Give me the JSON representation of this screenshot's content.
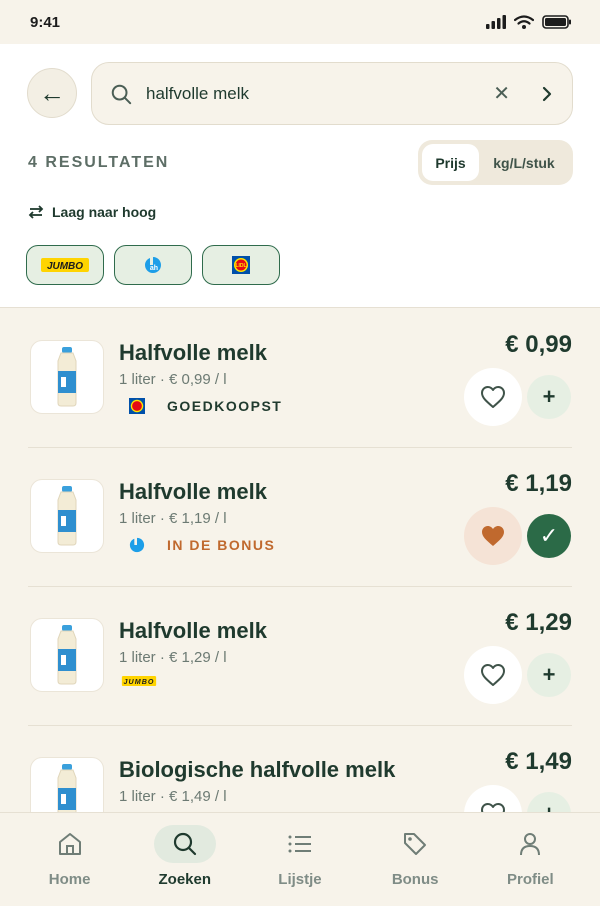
{
  "status": {
    "time": "9:41"
  },
  "search": {
    "query": "halfvolle melk"
  },
  "results": {
    "count_label": "4 RESULTATEN"
  },
  "toggle": {
    "options": [
      "Prijs",
      "kg/L/stuk"
    ],
    "active": "Prijs"
  },
  "sort": {
    "label": "Laag naar hoog"
  },
  "store_filters": [
    {
      "name": "JUMBO",
      "logo": "jumbo-logo"
    },
    {
      "name": "AH",
      "logo": "ah-logo"
    },
    {
      "name": "LIDL",
      "logo": "lidl-logo"
    }
  ],
  "products": [
    {
      "name": "Halfvolle melk",
      "meta": "1 liter · € 0,99 / l",
      "price": "€ 0,99",
      "store": "lidl-logo",
      "tag": "GOEDKOOPST",
      "tag_color": "#1f3a2e",
      "favorite": false,
      "added": false
    },
    {
      "name": "Halfvolle melk",
      "meta": "1 liter · € 1,19 / l",
      "price": "€ 1,19",
      "store": "ah-logo",
      "tag": "IN DE BONUS",
      "tag_color": "#c0692e",
      "favorite": true,
      "added": true
    },
    {
      "name": "Halfvolle melk",
      "meta": "1 liter · € 1,29 / l",
      "price": "€ 1,29",
      "store": "jumbo-logo",
      "tag": "",
      "tag_color": "#1f3a2e",
      "favorite": false,
      "added": false
    },
    {
      "name": "Biologische halfvolle melk",
      "meta": "1 liter · € 1,49 / l",
      "price": "€ 1,49",
      "store": "",
      "tag": "",
      "tag_color": "#1f3a2e",
      "favorite": false,
      "added": false
    }
  ],
  "tabs": [
    {
      "label": "Home",
      "icon": "home-icon"
    },
    {
      "label": "Zoeken",
      "icon": "search-icon"
    },
    {
      "label": "Lijstje",
      "icon": "list-icon"
    },
    {
      "label": "Bonus",
      "icon": "tag-icon"
    },
    {
      "label": "Profiel",
      "icon": "user-icon"
    }
  ],
  "colors": {
    "accent_green": "#2b6a47",
    "bonus_orange": "#c0692e",
    "background": "#f7f3ea"
  }
}
